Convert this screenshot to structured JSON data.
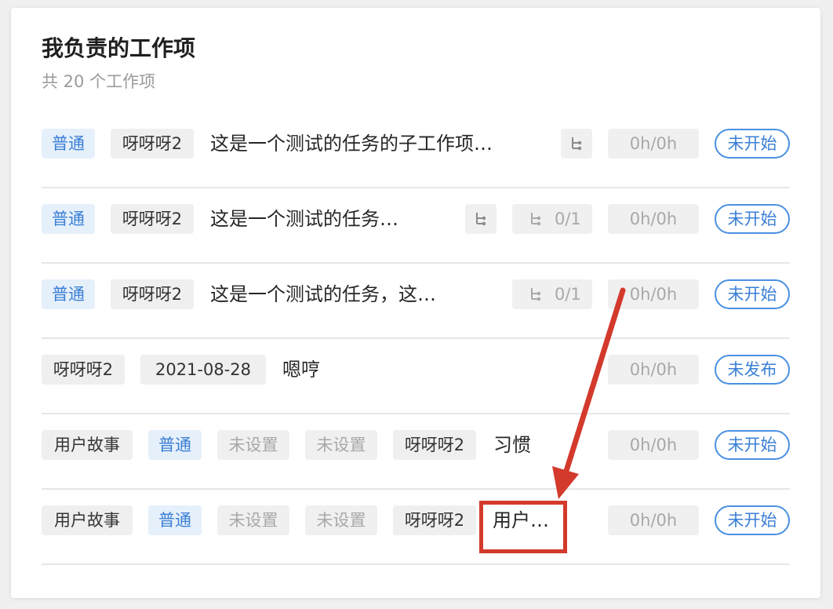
{
  "header": {
    "title": "我负责的工作项",
    "subtitle": "共 20 个工作项"
  },
  "rows": [
    {
      "priority": "普通",
      "assignee": "呀呀呀2",
      "title": "这是一个测试的任务的子工作项…",
      "time": "0h/0h",
      "status": "未开始"
    },
    {
      "priority": "普通",
      "assignee": "呀呀呀2",
      "title": "这是一个测试的任务…",
      "subtasks": "0/1",
      "time": "0h/0h",
      "status": "未开始"
    },
    {
      "priority": "普通",
      "assignee": "呀呀呀2",
      "title": "这是一个测试的任务，这…",
      "subtasks": "0/1",
      "time": "0h/0h",
      "status": "未开始"
    },
    {
      "assignee": "呀呀呀2",
      "date": "2021-08-28",
      "title": "嗯哼",
      "time": "0h/0h",
      "status": "未发布"
    },
    {
      "type": "用户故事",
      "priority": "普通",
      "field1": "未设置",
      "field2": "未设置",
      "assignee": "呀呀呀2",
      "title": "习惯",
      "time": "0h/0h",
      "status": "未开始"
    },
    {
      "type": "用户故事",
      "priority": "普通",
      "field1": "未设置",
      "field2": "未设置",
      "assignee": "呀呀呀2",
      "title": "用户…",
      "time": "0h/0h",
      "status": "未开始"
    }
  ],
  "icons": {
    "parent_link": "subtask-tree-icon",
    "subtask_count": "subtask-tree-icon"
  },
  "colors": {
    "accent_blue": "#4a90e2",
    "annotation_red": "#d33a2c"
  }
}
